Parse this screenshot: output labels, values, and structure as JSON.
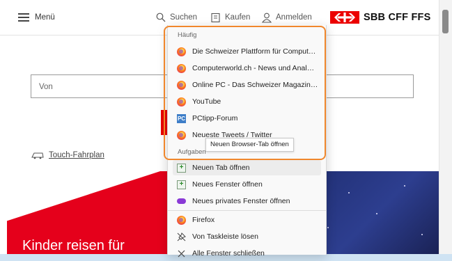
{
  "header": {
    "menu_label": "Menü",
    "search_label": "Suchen",
    "buy_label": "Kaufen",
    "login_label": "Anmelden",
    "brand": "SBB CFF FFS"
  },
  "form": {
    "from_placeholder": "Von",
    "touch_link": "Touch-Fahrplan"
  },
  "hero": {
    "title": "Kinder reisen für"
  },
  "jumplist": {
    "frequent_title": "Häufig",
    "frequent": [
      {
        "label": "Die Schweizer Plattform für Comput…",
        "icon": "firefox-icon"
      },
      {
        "label": "Computerworld.ch - News und Anal…",
        "icon": "firefox-icon"
      },
      {
        "label": "Online PC - Das Schweizer Magazin…",
        "icon": "firefox-icon"
      },
      {
        "label": "YouTube",
        "icon": "firefox-icon"
      },
      {
        "label": "PCtipp-Forum",
        "icon": "pctipp-icon"
      },
      {
        "label": "Neueste Tweets / Twitter",
        "icon": "firefox-icon"
      }
    ],
    "tasks_title": "Aufgaben",
    "tasks": [
      {
        "label": "Neuen Tab öffnen",
        "icon": "new-tab-icon"
      },
      {
        "label": "Neues Fenster öffnen",
        "icon": "new-window-icon"
      },
      {
        "label": "Neues privates Fenster öffnen",
        "icon": "private-window-icon"
      }
    ],
    "app": [
      {
        "label": "Firefox",
        "icon": "firefox-icon"
      },
      {
        "label": "Von Taskleiste lösen",
        "icon": "unpin-icon"
      },
      {
        "label": "Alle Fenster schließen",
        "icon": "close-icon"
      }
    ],
    "tooltip": "Neuen Browser-Tab öffnen"
  },
  "colors": {
    "highlight": "#f0872c",
    "brand_red": "#eb0000"
  }
}
